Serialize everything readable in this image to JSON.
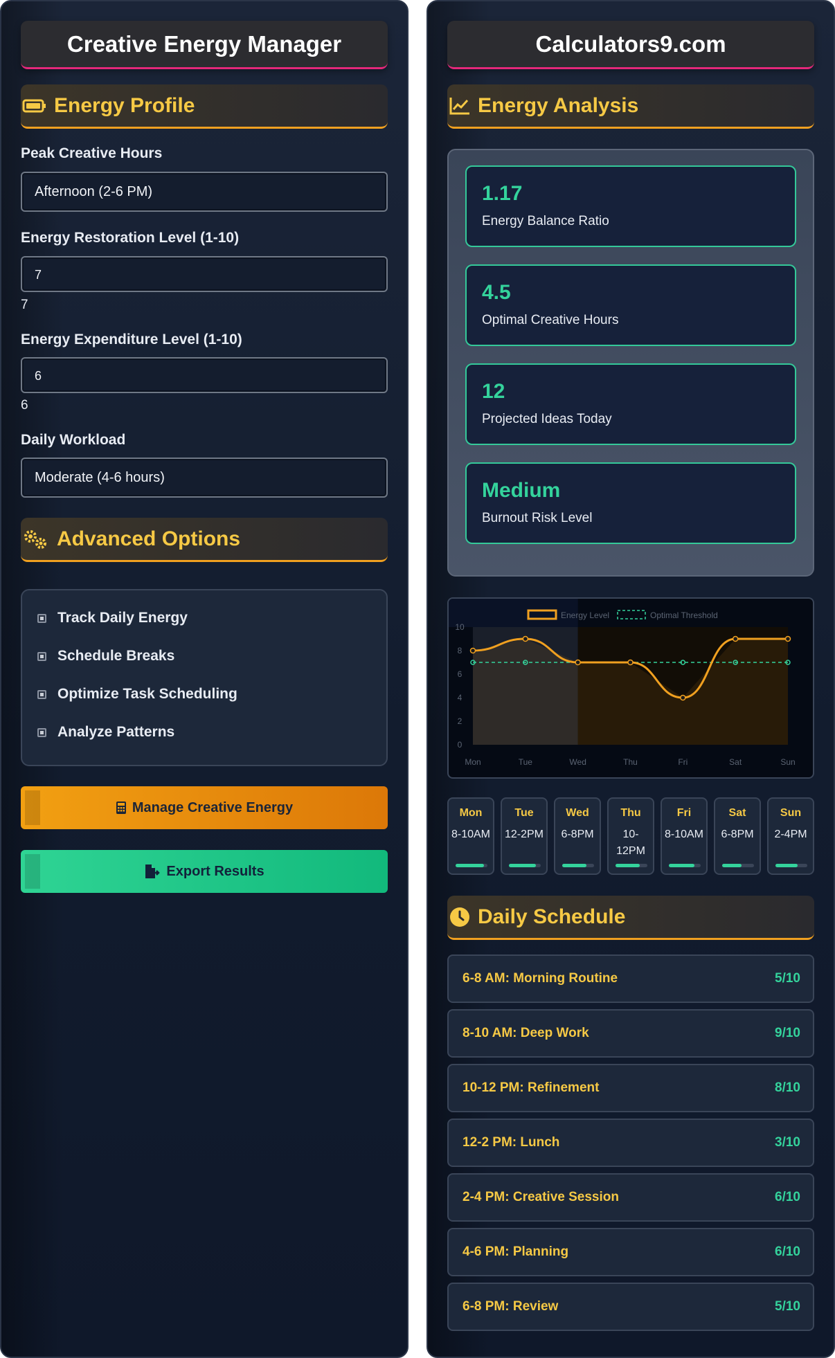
{
  "left": {
    "title": "Creative Energy Manager",
    "profile": {
      "heading": "Energy Profile",
      "icon": "battery-icon",
      "peak_label": "Peak Creative Hours",
      "peak_value": "Afternoon (2-6 PM)",
      "restoration_label": "Energy Restoration Level (1-10)",
      "restoration_value": "7",
      "restoration_display": "7",
      "expenditure_label": "Energy Expenditure Level (1-10)",
      "expenditure_value": "6",
      "expenditure_display": "6",
      "workload_label": "Daily Workload",
      "workload_value": "Moderate (4-6 hours)"
    },
    "advanced": {
      "heading": "Advanced Options",
      "icon": "gears-icon",
      "options": [
        "Track Daily Energy",
        "Schedule Breaks",
        "Optimize Task Scheduling",
        "Analyze Patterns"
      ]
    },
    "buttons": {
      "manage_label": "Manage Creative Energy",
      "manage_icon": "calculator-icon",
      "export_label": "Export Results",
      "export_icon": "file-export-icon"
    }
  },
  "right": {
    "title": "Calculators9.com",
    "analysis": {
      "heading": "Energy Analysis",
      "icon": "chart-line-icon",
      "stats": [
        {
          "value": "1.17",
          "label": "Energy Balance Ratio"
        },
        {
          "value": "4.5",
          "label": "Optimal Creative Hours"
        },
        {
          "value": "12",
          "label": "Projected Ideas Today"
        },
        {
          "value": "Medium",
          "label": "Burnout Risk Level"
        }
      ]
    },
    "days": [
      {
        "name": "Mon",
        "time": "8-10AM",
        "level": 0.9
      },
      {
        "name": "Tue",
        "time": "12-2PM",
        "level": 0.85
      },
      {
        "name": "Wed",
        "time": "6-8PM",
        "level": 0.75
      },
      {
        "name": "Thu",
        "time": "10-12PM",
        "level": 0.75
      },
      {
        "name": "Fri",
        "time": "8-10AM",
        "level": 0.8
      },
      {
        "name": "Sat",
        "time": "6-8PM",
        "level": 0.6
      },
      {
        "name": "Sun",
        "time": "2-4PM",
        "level": 0.7
      }
    ],
    "schedule": {
      "heading": "Daily Schedule",
      "icon": "clock-icon",
      "items": [
        {
          "label": "6-8 AM: Morning Routine",
          "score": "5/10"
        },
        {
          "label": "8-10 AM: Deep Work",
          "score": "9/10"
        },
        {
          "label": "10-12 PM: Refinement",
          "score": "8/10"
        },
        {
          "label": "12-2 PM: Lunch",
          "score": "3/10"
        },
        {
          "label": "2-4 PM: Creative Session",
          "score": "6/10"
        },
        {
          "label": "4-6 PM: Planning",
          "score": "6/10"
        },
        {
          "label": "6-8 PM: Review",
          "score": "5/10"
        }
      ]
    }
  },
  "colors": {
    "accent_yellow": "#f6c945",
    "accent_green": "#34d39c",
    "accent_orange": "#f0a020",
    "accent_pink": "#e4287a",
    "panel_bg": "#1b2538"
  },
  "chart_data": {
    "type": "line",
    "categories": [
      "Mon",
      "Tue",
      "Wed",
      "Thu",
      "Fri",
      "Sat",
      "Sun"
    ],
    "series": [
      {
        "name": "Energy Level",
        "values": [
          8,
          9,
          7,
          7,
          4,
          9,
          9
        ],
        "color": "#f0a020"
      },
      {
        "name": "Optimal Threshold",
        "values": [
          7,
          7,
          7,
          7,
          7,
          7,
          7
        ],
        "color": "#34d39c",
        "dashed": true
      }
    ],
    "ylim": [
      0,
      10
    ],
    "yticks": [
      0,
      2,
      4,
      6,
      8,
      10
    ],
    "legend": "top-center",
    "grid": false
  }
}
